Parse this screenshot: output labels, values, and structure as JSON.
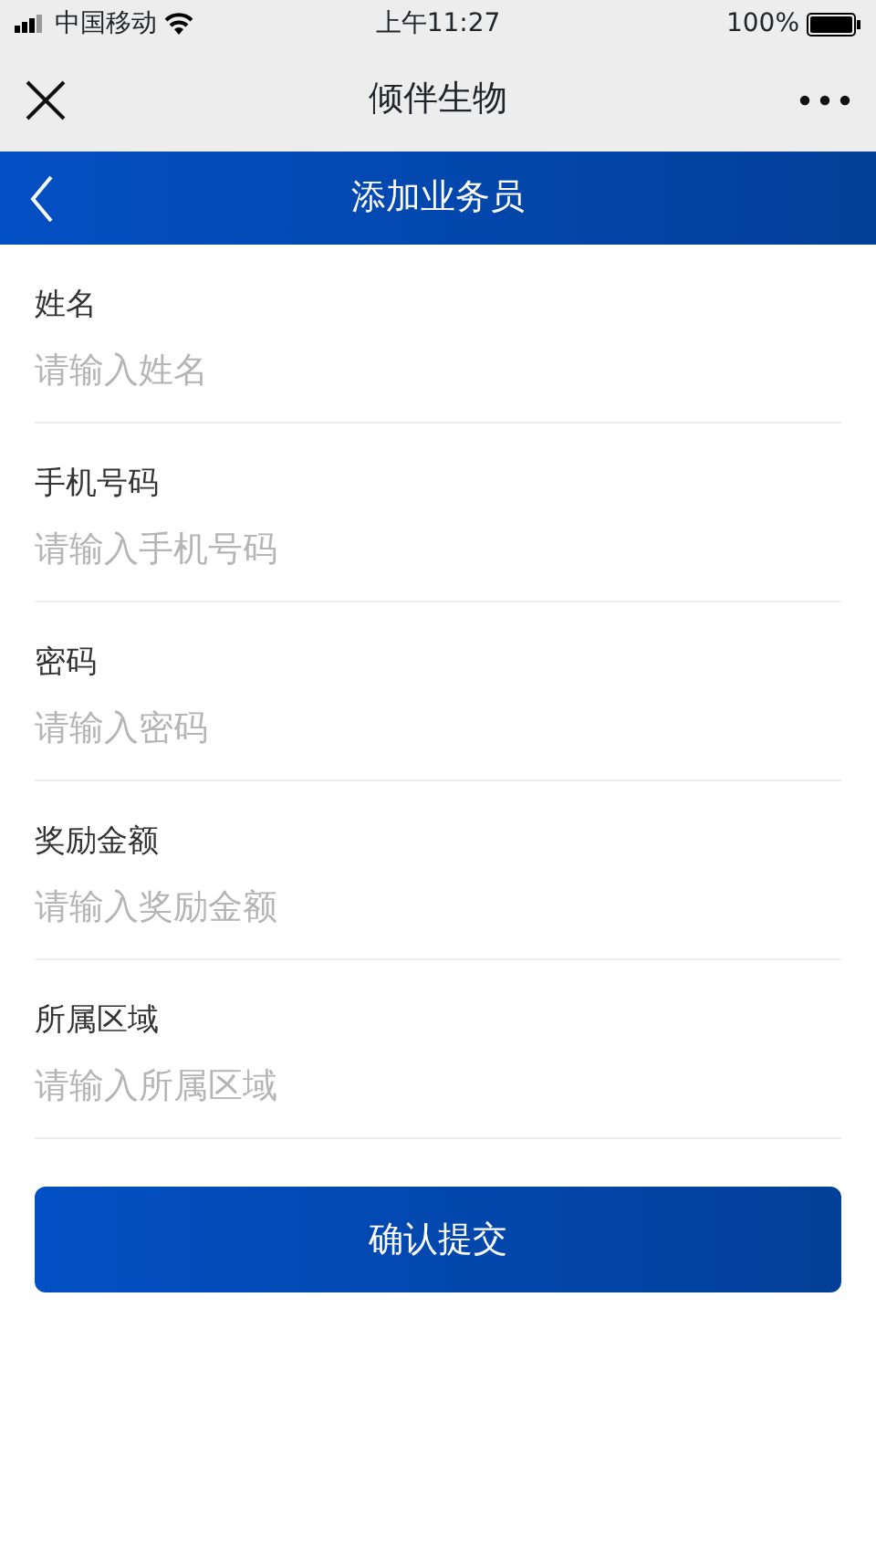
{
  "status_bar": {
    "carrier": "中国移动",
    "time": "上午11:27",
    "battery": "100%"
  },
  "app_bar": {
    "title": "倾伴生物"
  },
  "header": {
    "title": "添加业务员"
  },
  "fields": [
    {
      "label": "姓名",
      "placeholder": "请输入姓名"
    },
    {
      "label": "手机号码",
      "placeholder": "请输入手机号码"
    },
    {
      "label": "密码",
      "placeholder": "请输入密码"
    },
    {
      "label": "奖励金额",
      "placeholder": "请输入奖励金额"
    },
    {
      "label": "所属区域",
      "placeholder": "请输入所属区域"
    }
  ],
  "submit_button": "确认提交"
}
